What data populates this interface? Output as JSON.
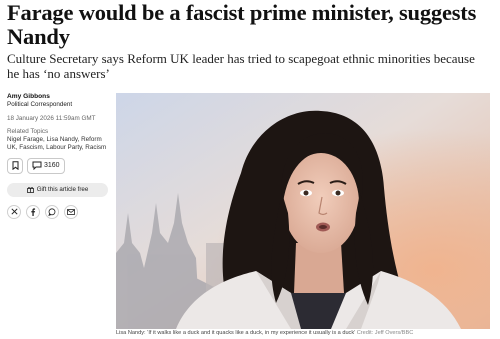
{
  "article": {
    "headline": "Farage would be a fascist prime minister, suggests Nandy",
    "standfirst": "Culture Secretary says Reform UK leader has tried to scapegoat ethnic minorities because he has ‘no answers’"
  },
  "author": {
    "name": "Amy Gibbons",
    "role": "Political Correspondent"
  },
  "published": "18 January 2026 11:59am GMT",
  "related": {
    "label": "Related Topics",
    "topics": "Nigel Farage, Lisa Nandy, Reform UK, Fascism, Labour Party, Racism"
  },
  "actions": {
    "comment_count": "3160",
    "gift_label": "Gift this article free"
  },
  "share": {
    "icons": [
      "x-icon",
      "facebook-icon",
      "whatsapp-icon",
      "email-icon"
    ]
  },
  "image": {
    "caption": "Lisa Nandy: ‘If it walks like a duck and it quacks like a duck, in my experience it usually is a duck’",
    "credit": "Credit: Jeff Overs/BBC"
  }
}
